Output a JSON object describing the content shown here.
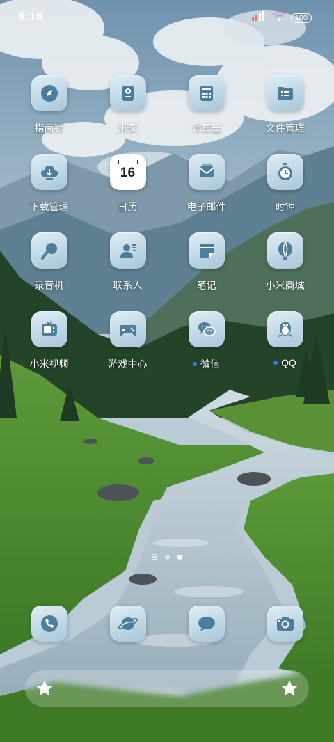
{
  "status": {
    "time": "8:16",
    "battery": "100"
  },
  "apps": [
    {
      "label": "指南针",
      "icon": "compass-icon"
    },
    {
      "label": "米家",
      "icon": "mijia-speaker-icon"
    },
    {
      "label": "计算器",
      "icon": "calculator-icon"
    },
    {
      "label": "文件管理",
      "icon": "folder-icon"
    },
    {
      "label": "下载管理",
      "icon": "cloud-download-icon"
    },
    {
      "label": "日历",
      "icon": "calendar-icon",
      "date": "16"
    },
    {
      "label": "电子邮件",
      "icon": "mail-icon"
    },
    {
      "label": "时钟",
      "icon": "stopwatch-icon"
    },
    {
      "label": "录音机",
      "icon": "microphone-icon"
    },
    {
      "label": "联系人",
      "icon": "contact-icon"
    },
    {
      "label": "笔记",
      "icon": "notes-icon"
    },
    {
      "label": "小米商城",
      "icon": "balloon-icon"
    },
    {
      "label": "小米视频",
      "icon": "tv-icon"
    },
    {
      "label": "游戏中心",
      "icon": "gamepad-icon"
    },
    {
      "label": "微信",
      "icon": "wechat-icon",
      "badge": true
    },
    {
      "label": "QQ",
      "icon": "qq-penguin-icon",
      "badge": true
    }
  ],
  "dock": [
    {
      "icon": "phone-icon"
    },
    {
      "icon": "browser-planet-icon"
    },
    {
      "icon": "message-bubble-icon"
    },
    {
      "icon": "camera-icon"
    }
  ],
  "page_indicator": {
    "pages": 2,
    "active": 2
  },
  "colors": {
    "icon_tint": "#4c7d9b",
    "badge": "#2f7bf5",
    "label": "#ffffff"
  }
}
